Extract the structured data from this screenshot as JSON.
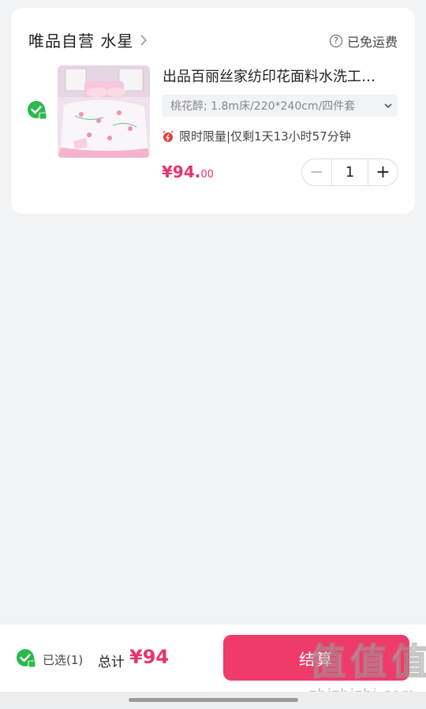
{
  "shop": {
    "name": "唯品自营 水星",
    "shipping": "已免运费"
  },
  "product": {
    "title": "出品百丽丝家纺印花面料水洗工…",
    "sku": "桃花醉; 1.8m床/220*240cm/四件套",
    "limit_text": "限时限量|仅剩1天13小时57分钟",
    "price_main": "¥94.",
    "price_cents": "00",
    "quantity": "1",
    "minus": "−",
    "plus": "+"
  },
  "footer": {
    "selected": "已选(1)",
    "total_label": "总计",
    "total_value": "¥94",
    "checkout_label": "结算"
  },
  "watermark": {
    "chars": [
      "值",
      "值",
      "值"
    ],
    "url": "zhizhizhi.com"
  },
  "colors": {
    "accent": "#ee3b6a",
    "price": "#e8336b",
    "check": "#2db84c",
    "background": "#f2f3f5"
  }
}
